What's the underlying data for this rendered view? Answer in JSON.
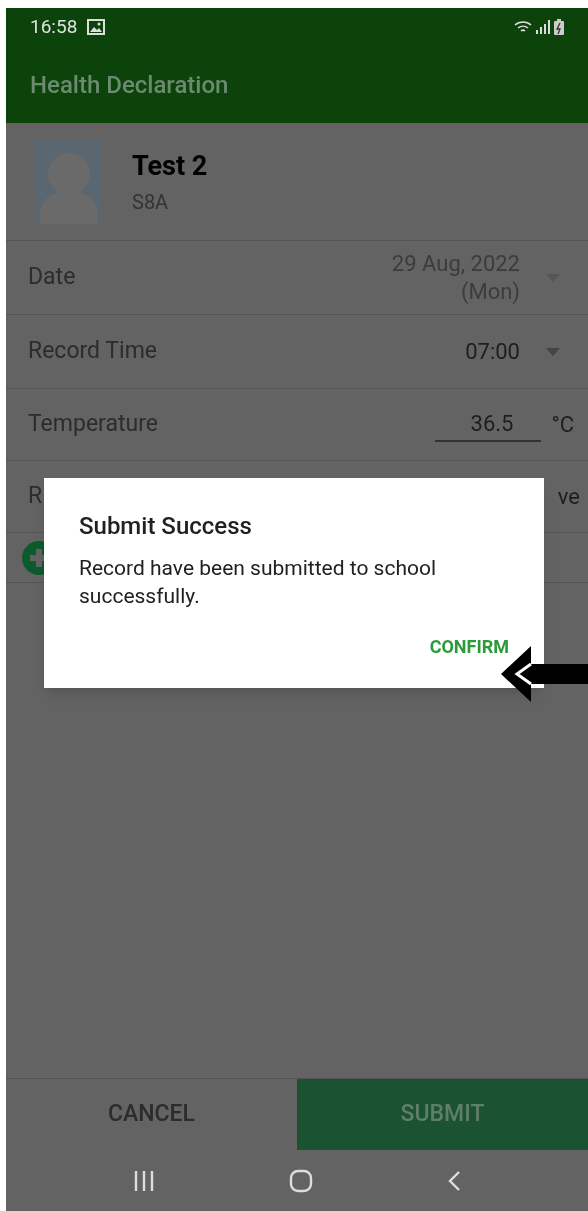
{
  "status_bar": {
    "time": "16:58"
  },
  "toolbar": {
    "title": "Health Declaration"
  },
  "profile": {
    "name": "Test 2",
    "class": "S8A"
  },
  "fields": [
    {
      "kind": "dropdown",
      "label": "Date",
      "value_lines": [
        "29 Aug, 2022",
        "(Mon)"
      ],
      "disabled": true
    },
    {
      "kind": "dropdown",
      "label": "Record Time",
      "value_lines": [
        "07:00"
      ],
      "disabled": false
    },
    {
      "kind": "input",
      "label": "Temperature",
      "value": "36.5",
      "unit": "°C"
    },
    {
      "kind": "covered",
      "label": "R",
      "value": "ve"
    }
  ],
  "dialog": {
    "title": "Submit Success",
    "message": "Record have been submitted to school successfully.",
    "button": "CONFIRM"
  },
  "bottom_buttons": [
    {
      "label": "CANCEL",
      "kind": "cancel"
    },
    {
      "label": "SUBMIT",
      "kind": "submit"
    }
  ]
}
